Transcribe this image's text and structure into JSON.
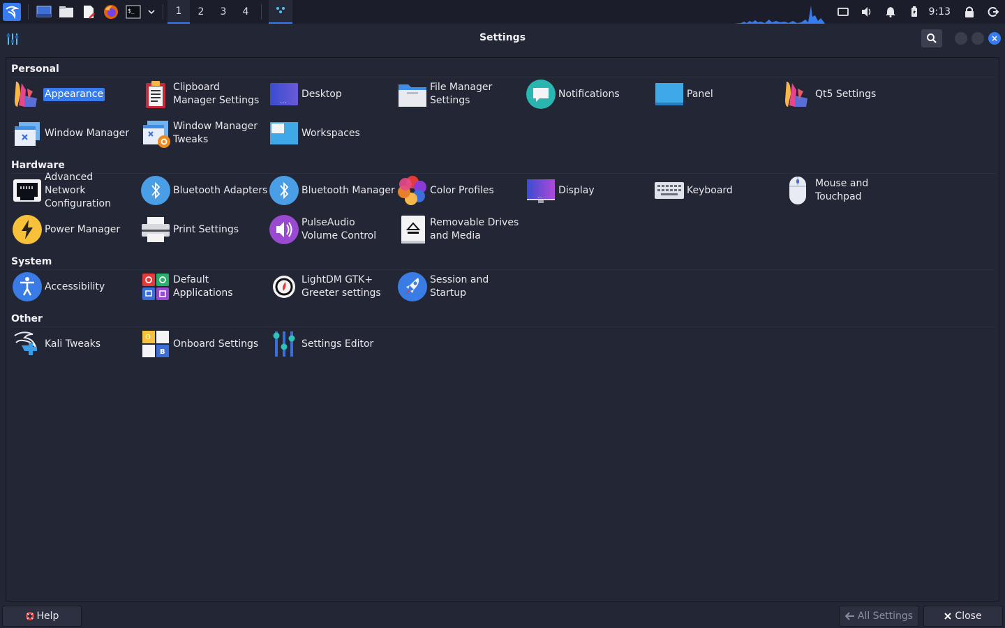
{
  "panel": {
    "workspaces": [
      "1",
      "2",
      "3",
      "4"
    ],
    "clock": "9:13"
  },
  "window": {
    "title": "Settings"
  },
  "categories": {
    "personal": "Personal",
    "hardware": "Hardware",
    "system": "System",
    "other": "Other"
  },
  "personal": [
    {
      "label": "Appearance",
      "icon": "appearance-icon"
    },
    {
      "label": "Clipboard Manager Settings",
      "icon": "clipboard-icon"
    },
    {
      "label": "Desktop",
      "icon": "desktop-icon"
    },
    {
      "label": "File Manager Settings",
      "icon": "folder-icon"
    },
    {
      "label": "Notifications",
      "icon": "notification-icon"
    },
    {
      "label": "Panel",
      "icon": "panel-icon"
    },
    {
      "label": "Qt5 Settings",
      "icon": "qt5-icon"
    },
    {
      "label": "Window Manager",
      "icon": "window-manager-icon"
    },
    {
      "label": "Window Manager Tweaks",
      "icon": "window-tweaks-icon"
    },
    {
      "label": "Workspaces",
      "icon": "workspaces-icon"
    }
  ],
  "hardware": [
    {
      "label": "Advanced Network Configuration",
      "icon": "network-icon"
    },
    {
      "label": "Bluetooth Adapters",
      "icon": "bluetooth-icon"
    },
    {
      "label": "Bluetooth Manager",
      "icon": "bluetooth-icon"
    },
    {
      "label": "Color Profiles",
      "icon": "color-profiles-icon"
    },
    {
      "label": "Display",
      "icon": "display-icon"
    },
    {
      "label": "Keyboard",
      "icon": "keyboard-icon"
    },
    {
      "label": "Mouse and Touchpad",
      "icon": "mouse-icon"
    },
    {
      "label": "Power Manager",
      "icon": "power-icon"
    },
    {
      "label": "Print Settings",
      "icon": "printer-icon"
    },
    {
      "label": "PulseAudio Volume Control",
      "icon": "volume-icon"
    },
    {
      "label": "Removable Drives and Media",
      "icon": "eject-icon"
    }
  ],
  "system": [
    {
      "label": "Accessibility",
      "icon": "accessibility-icon"
    },
    {
      "label": "Default Applications",
      "icon": "default-apps-icon"
    },
    {
      "label": "LightDM GTK+ Greeter settings",
      "icon": "lightdm-icon"
    },
    {
      "label": "Session and Startup",
      "icon": "rocket-icon"
    }
  ],
  "other": [
    {
      "label": "Kali Tweaks",
      "icon": "kali-dragon-icon"
    },
    {
      "label": "Onboard Settings",
      "icon": "onboard-icon"
    },
    {
      "label": "Settings Editor",
      "icon": "settings-editor-icon"
    }
  ],
  "buttons": {
    "help": "Help",
    "all_settings": "All Settings",
    "close": "Close"
  },
  "colors": {
    "accent": "#367bf0",
    "background": "#232635",
    "panel": "#1b1e2a"
  }
}
